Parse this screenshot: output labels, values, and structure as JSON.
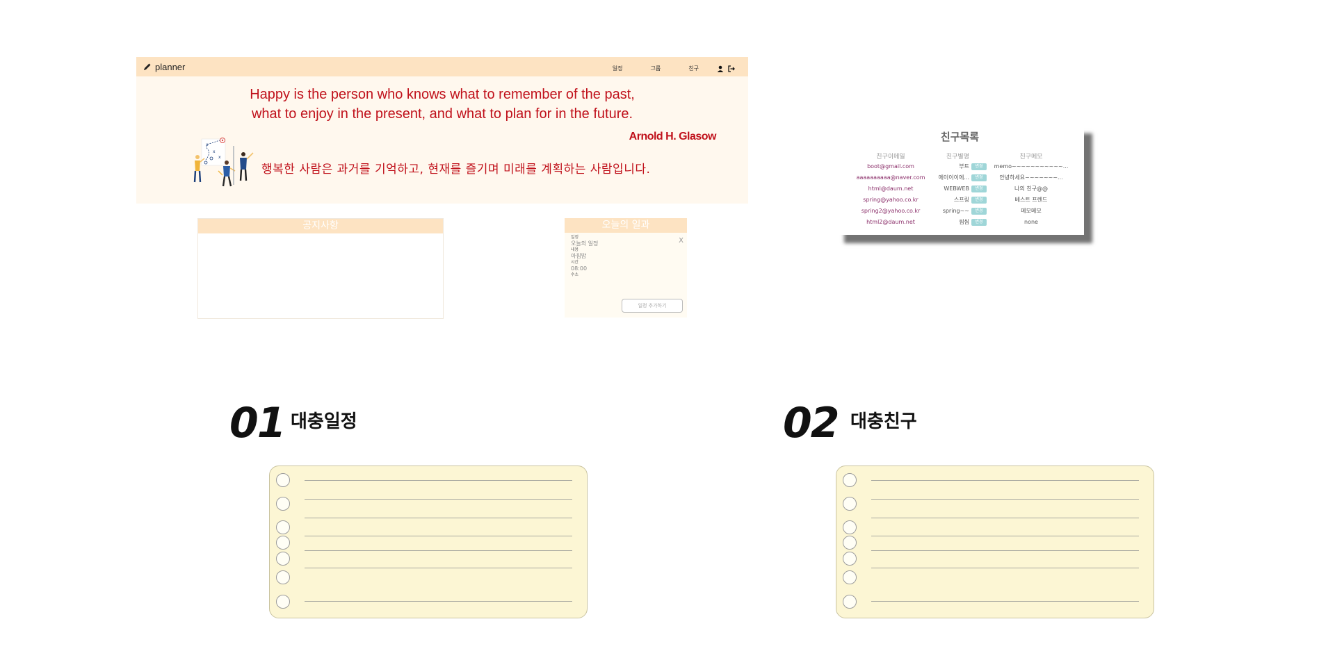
{
  "navbar": {
    "brand": "planner",
    "links": [
      "일정",
      "그룹",
      "친구"
    ],
    "icons": [
      "pencil-icon",
      "user-icon",
      "logout-icon"
    ],
    "color": "#fde3c2"
  },
  "hero": {
    "quote_en_line1": "Happy is the person who knows what to remember of the past,",
    "quote_en_line2": "what to enjoy in the present, and what to plan for in the future.",
    "author": "Arnold H. Glasow",
    "quote_ko": "행복한 사람은 과거를 기억하고, 현재를 즐기며 미래를 계획하는 사람입니다.",
    "text_color": "#c0111b"
  },
  "notice": {
    "title": "공지사항"
  },
  "today": {
    "title": "오늘의 일과",
    "close": "X",
    "fields": [
      {
        "label": "일정",
        "value": "오늘의 일정"
      },
      {
        "label": "내용",
        "value": "아침밥"
      },
      {
        "label": "시간",
        "value": "08:00"
      },
      {
        "label": "수소",
        "value": ""
      }
    ],
    "add_button": "일정 추가하기"
  },
  "friends": {
    "title": "친구목록",
    "headers": [
      "친구이메일",
      "친구별명",
      "",
      "친구메모"
    ],
    "edit_label": "변경",
    "rows": [
      {
        "email": "boot@gmail.com",
        "nick": "부트",
        "memo": "memo~~~~~~~~~~~..."
      },
      {
        "email": "aaaaaaaaaa@naver.com",
        "nick": "에이이이에...",
        "memo": "안녕하세요~~~~~~~..."
      },
      {
        "email": "html@daum.net",
        "nick": "WEBWEB",
        "memo": "나의 친구@@"
      },
      {
        "email": "spring@yahoo.co.kr",
        "nick": "스프링",
        "memo": "베스트 프렌드"
      },
      {
        "email": "spring2@yahoo.co.kr",
        "nick": "spring~~",
        "memo": "메모메모"
      },
      {
        "email": "html2@daum.net",
        "nick": "씸씸",
        "memo": "none"
      }
    ]
  },
  "sections": [
    {
      "number": "01",
      "title": "대충일정"
    },
    {
      "number": "02",
      "title": "대충친구"
    }
  ],
  "notepad_color": "#fcf6d4"
}
